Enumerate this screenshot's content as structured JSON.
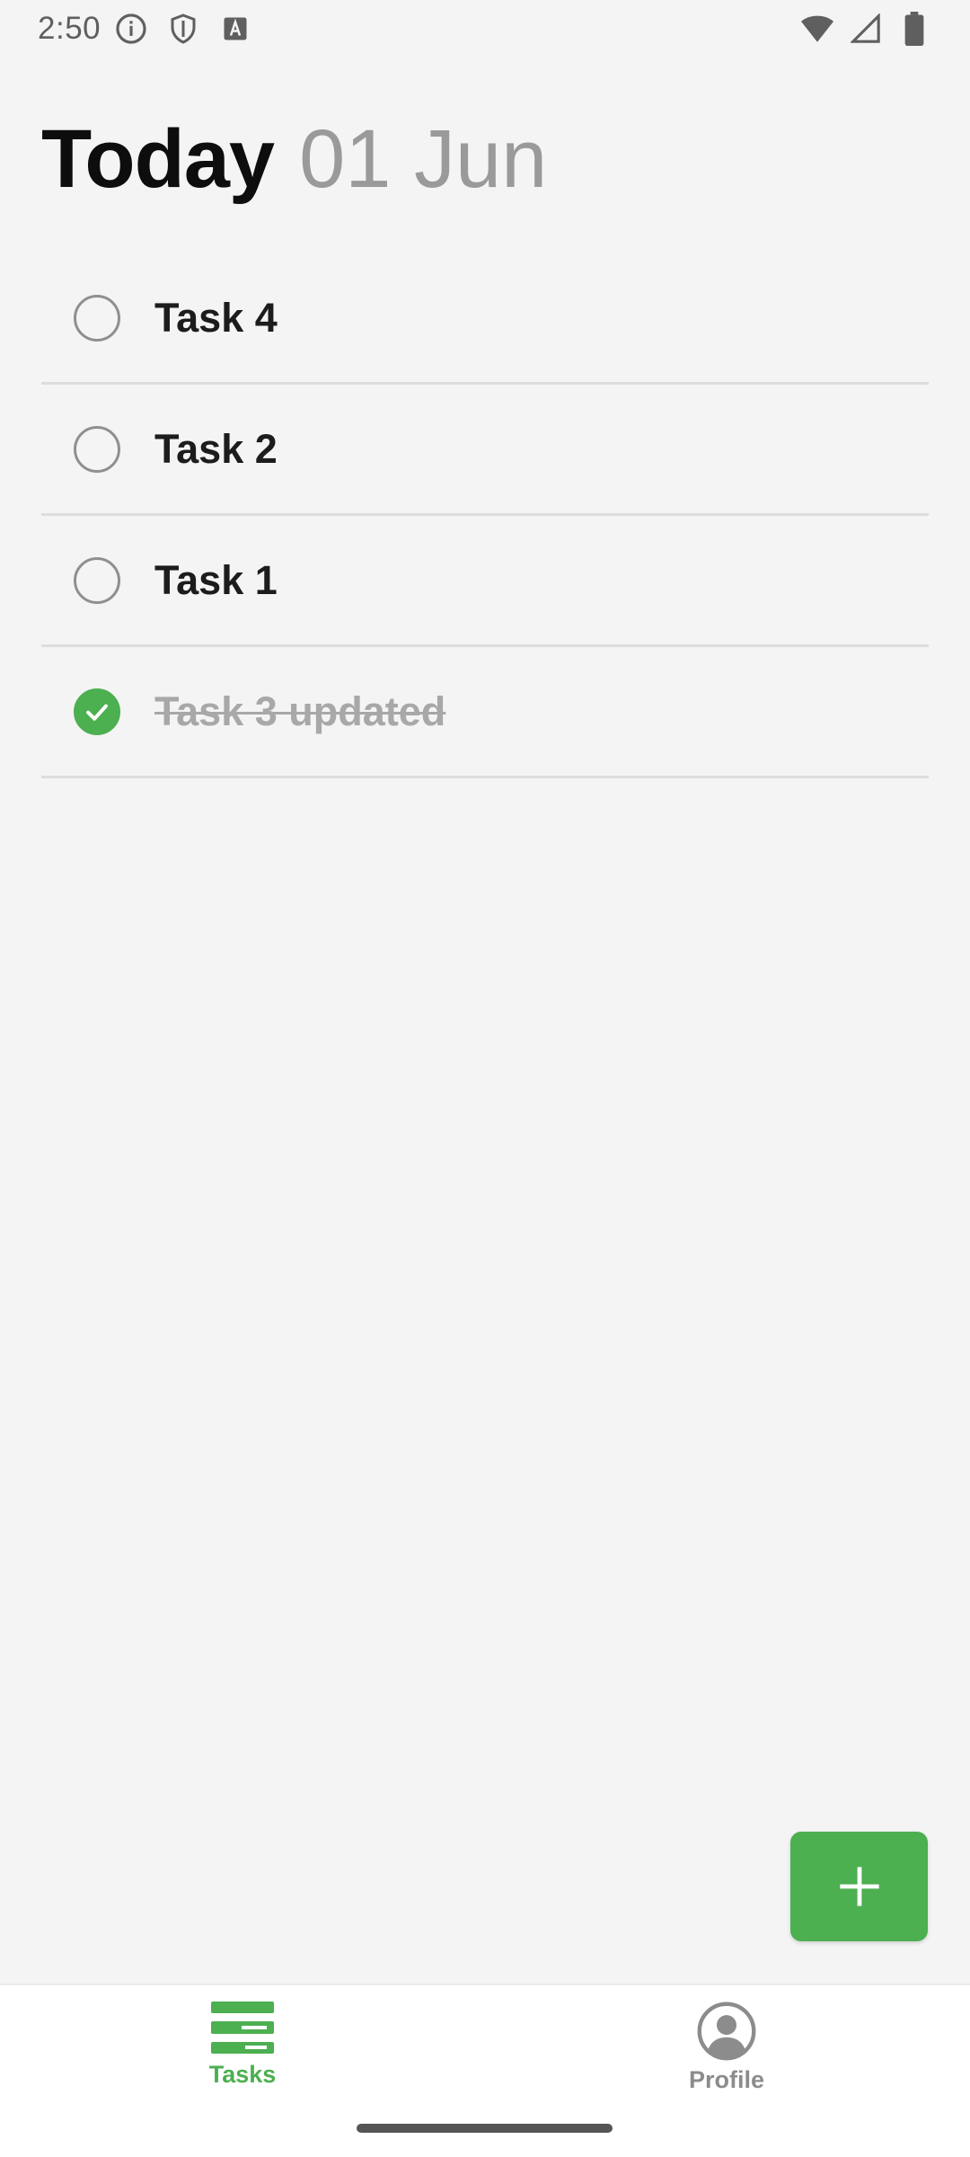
{
  "status_bar": {
    "time": "2:50",
    "left_icons": [
      "info-icon",
      "shield-icon",
      "font-icon"
    ],
    "right_icons": [
      "wifi-icon",
      "signal-icon",
      "battery-icon"
    ]
  },
  "header": {
    "title": "Today",
    "date": "01 Jun"
  },
  "tasks": [
    {
      "label": "Task 4",
      "done": false
    },
    {
      "label": "Task 2",
      "done": false
    },
    {
      "label": "Task 1",
      "done": false
    },
    {
      "label": "Task 3 updated",
      "done": true
    }
  ],
  "fab": {
    "icon": "plus-icon"
  },
  "bottom_nav": {
    "items": [
      {
        "label": "Tasks",
        "icon": "tasks-icon",
        "active": true
      },
      {
        "label": "Profile",
        "icon": "profile-icon",
        "active": false
      }
    ]
  },
  "colors": {
    "accent": "#4caf50",
    "background": "#f4f4f4",
    "title": "#0d0d0d",
    "date": "#9a9a9a",
    "done_text": "#a8a8a8"
  }
}
